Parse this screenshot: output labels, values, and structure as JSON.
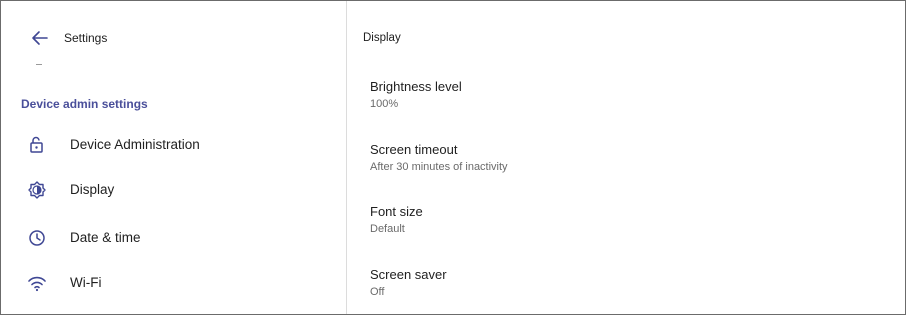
{
  "header": {
    "title": "Settings",
    "back_icon": "back-arrow-icon"
  },
  "sidebar": {
    "section_title": "Device admin settings",
    "items": [
      {
        "label": "Device Administration",
        "icon": "lock-open-icon"
      },
      {
        "label": "Display",
        "icon": "brightness-icon"
      },
      {
        "label": "Date & time",
        "icon": "clock-icon"
      },
      {
        "label": "Wi-Fi",
        "icon": "wifi-icon"
      }
    ]
  },
  "main": {
    "title": "Display",
    "settings": [
      {
        "title": "Brightness level",
        "value": "100%"
      },
      {
        "title": "Screen timeout",
        "value": "After 30 minutes of inactivity"
      },
      {
        "title": "Font size",
        "value": "Default"
      },
      {
        "title": "Screen saver",
        "value": "Off"
      }
    ]
  },
  "colors": {
    "accent": "#4a4f9a",
    "icon": "#3f4794"
  }
}
